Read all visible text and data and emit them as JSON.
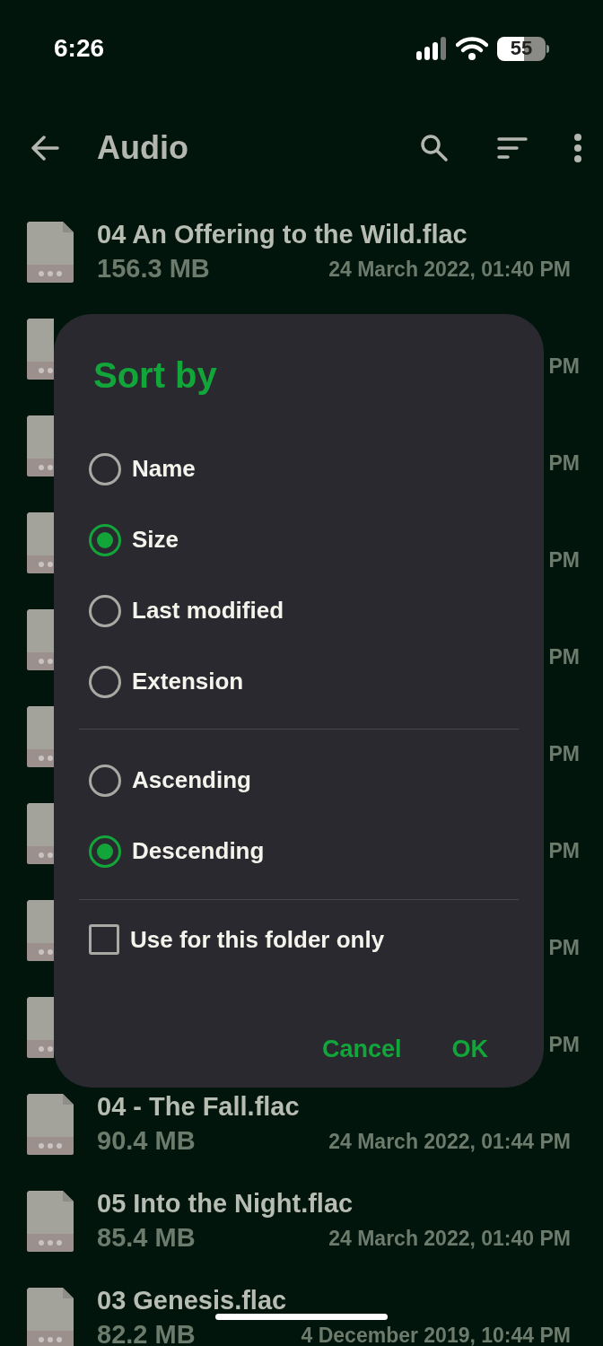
{
  "status_bar": {
    "time": "6:26",
    "battery": "55"
  },
  "toolbar": {
    "title": "Audio"
  },
  "files": [
    {
      "name": "04 An Offering to the Wild.flac",
      "size": "156.3 MB",
      "modified": "24 March 2022, 01:40 PM"
    },
    {
      "modified": "PM"
    },
    {
      "modified": "PM"
    },
    {
      "modified": "PM"
    },
    {
      "modified": "PM"
    },
    {
      "modified": "PM"
    },
    {
      "modified": "PM"
    },
    {
      "modified": "PM"
    },
    {
      "modified": "PM"
    },
    {
      "name": "04 - The Fall.flac",
      "size": "90.4 MB",
      "modified": "24 March 2022, 01:44 PM"
    },
    {
      "name": "05 Into the Night.flac",
      "size": "85.4 MB",
      "modified": "24 March 2022, 01:40 PM"
    },
    {
      "name": "03 Genesis.flac",
      "size": "82.2 MB",
      "modified": "4 December 2019, 10:44 PM"
    }
  ],
  "dialog": {
    "title": "Sort by",
    "sort_fields": [
      {
        "label": "Name",
        "selected": false
      },
      {
        "label": "Size",
        "selected": true
      },
      {
        "label": "Last modified",
        "selected": false
      },
      {
        "label": "Extension",
        "selected": false
      }
    ],
    "orders": [
      {
        "label": "Ascending",
        "selected": false
      },
      {
        "label": "Descending",
        "selected": true
      }
    ],
    "folder_only": {
      "label": "Use for this folder only",
      "checked": false
    },
    "buttons": [
      "Cancel",
      "OK"
    ]
  }
}
